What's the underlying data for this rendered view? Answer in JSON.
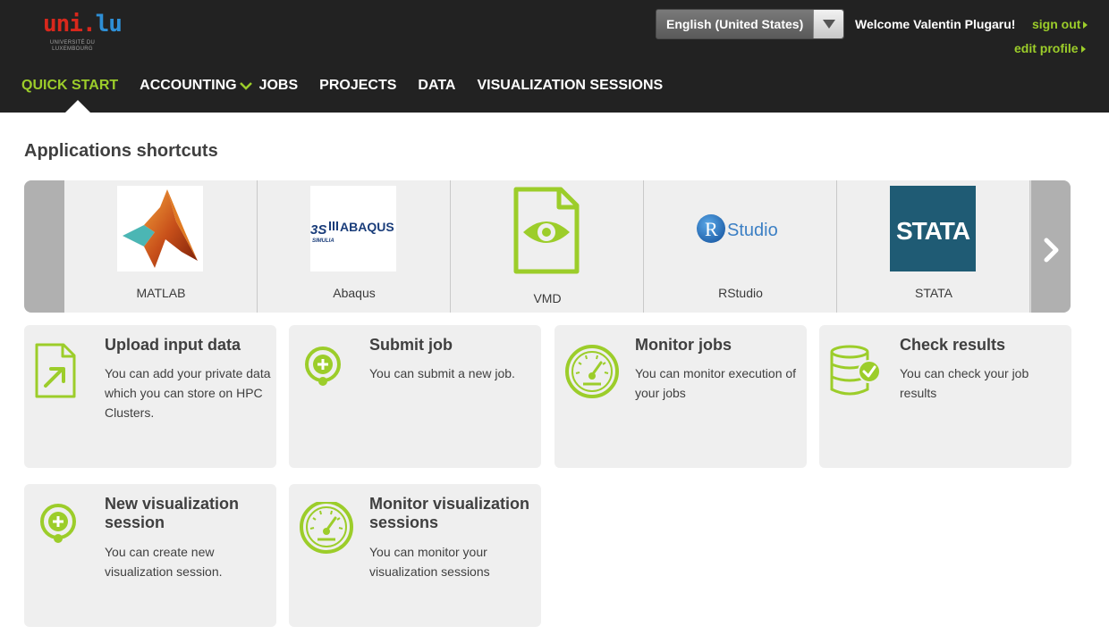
{
  "header": {
    "logo": {
      "text_red": "uni.",
      "text_blue": "lu",
      "subtitle": "UNIVERSITÉ DU LUXEMBOURG"
    },
    "language": {
      "selected": "English (United States)"
    },
    "welcome": "Welcome Valentin Plugaru!",
    "sign_out": "sign out",
    "edit_profile": "edit profile",
    "accent_color": "#9ccd2a"
  },
  "nav": {
    "items": [
      {
        "label": "QUICK START",
        "active": true
      },
      {
        "label": "ACCOUNTING",
        "has_dropdown": true
      },
      {
        "label": "JOBS"
      },
      {
        "label": "PROJECTS"
      },
      {
        "label": "DATA"
      },
      {
        "label": "VISUALIZATION SESSIONS"
      }
    ]
  },
  "shortcuts": {
    "title": "Applications shortcuts",
    "apps": [
      {
        "label": "MATLAB",
        "icon": "matlab-logo"
      },
      {
        "label": "Abaqus",
        "icon": "abaqus-logo",
        "logo_text": "ABAQUS",
        "logo_sub": "SIMULIA"
      },
      {
        "label": "VMD",
        "icon": "document-eye-icon"
      },
      {
        "label": "RStudio",
        "icon": "rstudio-logo",
        "logo_letter": "R",
        "logo_text": "Studio"
      },
      {
        "label": "STATA",
        "icon": "stata-logo",
        "logo_text": "STATA"
      }
    ]
  },
  "cards": [
    {
      "title": "Upload input data",
      "desc": "You can add your private data which you can store on HPC Clusters.",
      "icon": "upload-document-icon"
    },
    {
      "title": "Submit job",
      "desc": "You can submit a new job.",
      "icon": "plus-circle-icon"
    },
    {
      "title": "Monitor jobs",
      "desc": "You can monitor execution of your jobs",
      "icon": "gauge-icon"
    },
    {
      "title": "Check results",
      "desc": "You can check your job results",
      "icon": "database-check-icon"
    },
    {
      "title": "New visualization session",
      "desc": "You can create new visualization session.",
      "icon": "plus-circle-icon"
    },
    {
      "title": "Monitor visualization sessions",
      "desc": "You can monitor your visualization sessions",
      "icon": "gauge-icon"
    }
  ]
}
